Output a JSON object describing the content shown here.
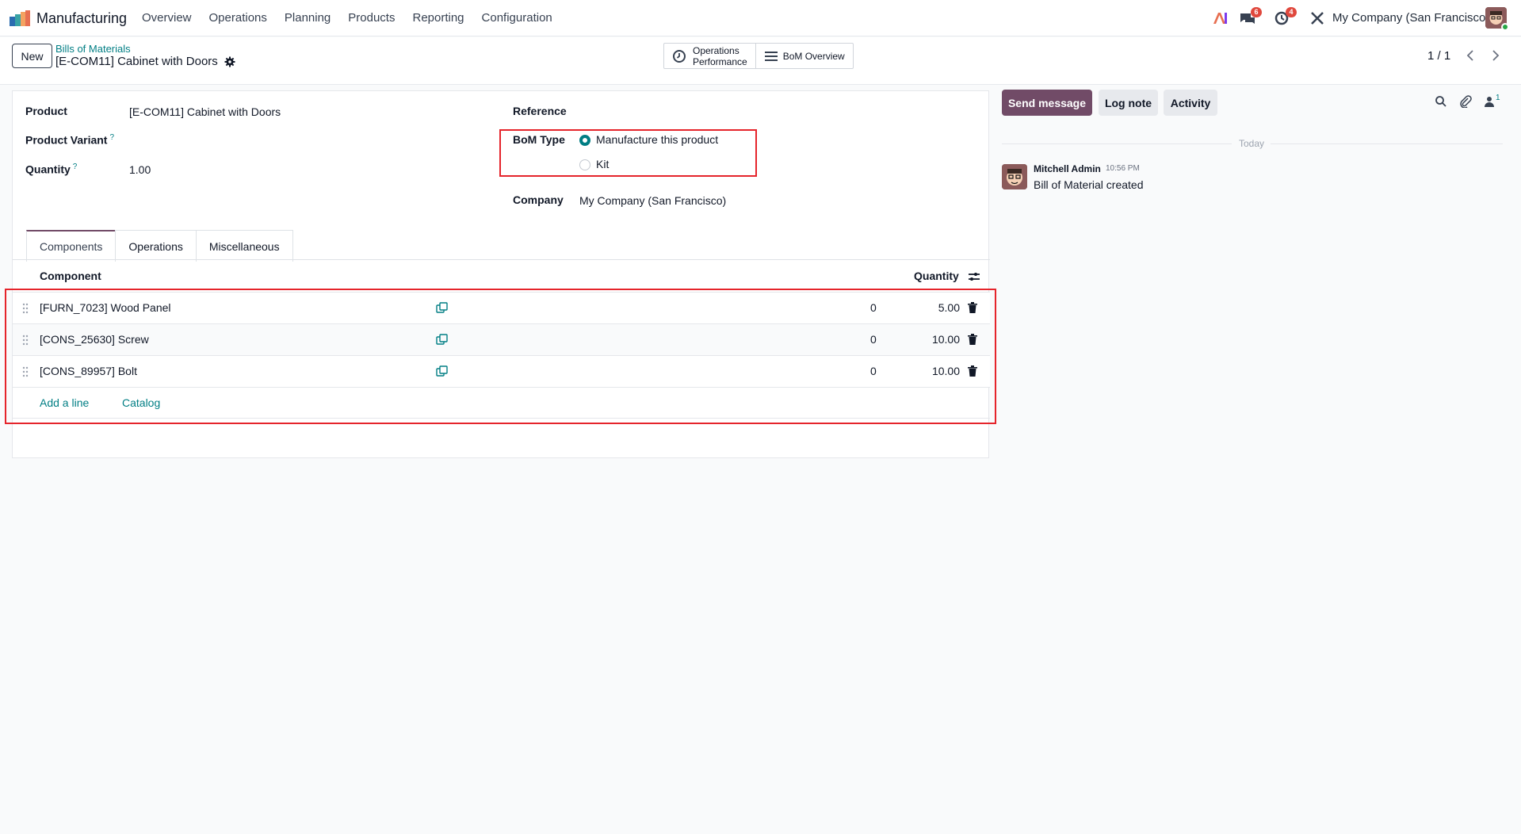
{
  "app": {
    "name": "Manufacturing"
  },
  "menu": [
    "Overview",
    "Operations",
    "Planning",
    "Products",
    "Reporting",
    "Configuration"
  ],
  "systray": {
    "messages_badge": "6",
    "activities_badge": "4",
    "company": "My Company (San Francisco)"
  },
  "control": {
    "new_label": "New",
    "breadcrumb": "Bills of Materials",
    "record_title": "[E-COM11] Cabinet with Doors",
    "smart_buttons": {
      "ops_line1": "Operations",
      "ops_line2": "Performance",
      "bom_overview": "BoM Overview"
    },
    "pager": "1 / 1"
  },
  "form": {
    "product_label": "Product",
    "product_value": "[E-COM11] Cabinet with Doors",
    "variant_label": "Product Variant",
    "quantity_label": "Quantity",
    "quantity_value": "1.00",
    "help_mark": "?",
    "reference_label": "Reference",
    "bom_type_label": "BoM Type",
    "bom_type_options": [
      "Manufacture this product",
      "Kit"
    ],
    "company_label": "Company",
    "company_value": "My Company (San Francisco)"
  },
  "tabs": [
    "Components",
    "Operations",
    "Miscellaneous"
  ],
  "components": {
    "header_component": "Component",
    "header_quantity": "Quantity",
    "rows": [
      {
        "name": "[FURN_7023] Wood Panel",
        "zero": "0",
        "qty": "5.00"
      },
      {
        "name": "[CONS_25630] Screw",
        "zero": "0",
        "qty": "10.00"
      },
      {
        "name": "[CONS_89957] Bolt",
        "zero": "0",
        "qty": "10.00"
      }
    ],
    "add_line": "Add a line",
    "catalog": "Catalog"
  },
  "chatter": {
    "send_message": "Send message",
    "log_note": "Log note",
    "activity": "Activity",
    "followers_count": "1",
    "today": "Today",
    "author": "Mitchell Admin",
    "time": "10:56 PM",
    "body": "Bill of Material created"
  },
  "colors": {
    "brand": "#714b67",
    "link": "#017e84",
    "highlight": "#e5242b"
  }
}
